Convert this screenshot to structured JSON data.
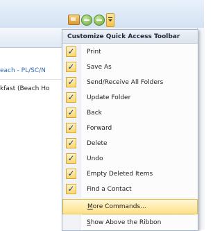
{
  "background": {
    "rows": [
      "each - PL/SC/N",
      "kfast (Beach Ho"
    ]
  },
  "toolbar": {
    "icons": [
      "send-receive-icon",
      "back-icon",
      "forward-icon",
      "customize-dropdown-icon"
    ]
  },
  "menu": {
    "title": "Customize Quick Access Toolbar",
    "check_glyph": "✓",
    "items": [
      {
        "label": "Print",
        "checked": true
      },
      {
        "label": "Save As",
        "checked": true
      },
      {
        "label": "Send/Receive All Folders",
        "checked": true
      },
      {
        "label": "Update Folder",
        "checked": true
      },
      {
        "label": "Back",
        "checked": true
      },
      {
        "label": "Forward",
        "checked": true
      },
      {
        "label": "Delete",
        "checked": true
      },
      {
        "label": "Undo",
        "checked": true
      },
      {
        "label": "Empty Deleted Items",
        "checked": true
      },
      {
        "label": "Find a Contact",
        "checked": true
      }
    ],
    "more_commands": {
      "accel": "M",
      "rest": "ore Commands..."
    },
    "show_above": {
      "accel": "S",
      "rest": "how Above the Ribbon"
    }
  }
}
